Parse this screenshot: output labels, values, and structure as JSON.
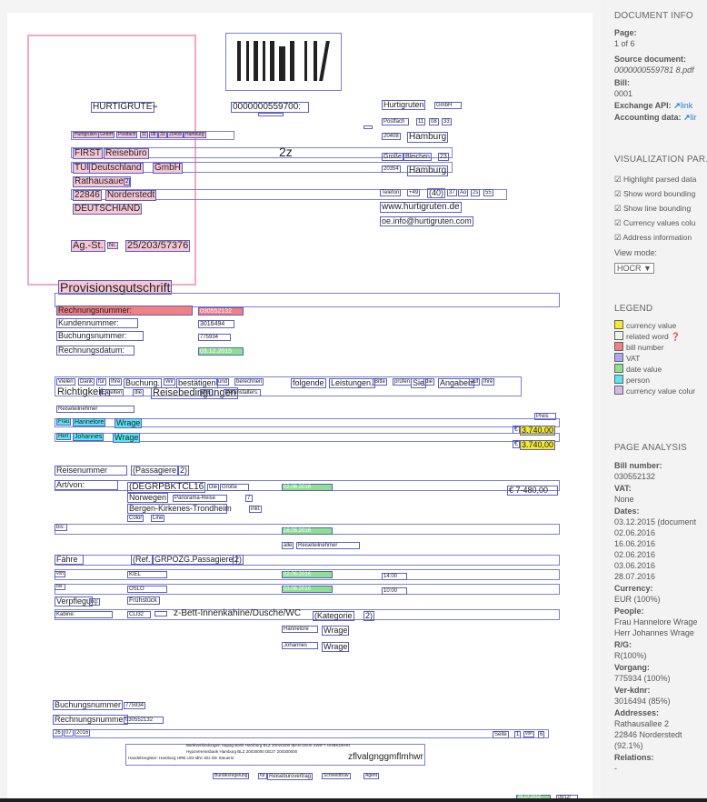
{
  "doc": {
    "company_top": "HURTIGRUTE",
    "company_top_mark": "™",
    "doc_number": "0000000559700:",
    "company_right": "Hurtigruten",
    "company_right_suffix": "GmbH",
    "sender_line": [
      "Hurtigruten",
      "GmbH",
      "Postfach",
      "11",
      "08",
      "33",
      "20408",
      "Hamburg"
    ],
    "postfach": [
      "Postfach",
      "11",
      "08",
      "33"
    ],
    "plz_hh1": "20408",
    "city_hh1": "Hamburg",
    "street_r": [
      "Große",
      "Bleichen",
      "23"
    ],
    "plz_hh2": "20354",
    "city_hh2": "Hamburg",
    "phone": [
      "Telefon",
      "+49",
      "(40)",
      "37",
      "Ao",
      "2s",
      "55"
    ],
    "web": "www.hurtigruten.de",
    "email": "oe.info@hurtigruten.com",
    "recipient": [
      "FIRST",
      "Reisebüro",
      "TUI",
      "Deutschland",
      "GmbH",
      "Rathausauee",
      "2",
      "22846",
      "Norderstedt",
      "DEUTSCHIAND"
    ],
    "zz": "2z",
    "agst": [
      "Ag.-St.",
      "Nr.",
      "25/203/57376"
    ],
    "title": "Provisionsgutschrift",
    "fields": {
      "rechnungsnummer_label": "Rechnungsnummer:",
      "rechnungsnummer": "030552132",
      "kundennummer_label": "Kundennummer:",
      "kundennummer": "3016494",
      "buchungsnummer_label": "Buchungsnummer:",
      "buchungsnummer": "775934",
      "rechnungsdatum_label": "Rechnungsdatum:",
      "rechnungsdatum": "03.12.2015"
    },
    "thanks_line": [
      "Vielen",
      "Dank",
      "für",
      "Ihre",
      "Buchung.",
      "Wir",
      "bestätigen",
      "und",
      "berechnen",
      "folgende",
      "Leistungen.",
      "Bitte",
      "prüfen",
      "Sie",
      "die",
      "Angaben",
      "auf",
      "Ihre"
    ],
    "rules_line": [
      "Richtigkeit.",
      "Es",
      "gelten",
      "die",
      "Reisebedingungen",
      "des",
      "Veranstalters."
    ],
    "reiseteilnehmer": "Reiseteilnehmer",
    "preis": "Preis",
    "pax": [
      {
        "title": "Frau",
        "first": "Hannelore",
        "last": "Wrage",
        "cur": "€",
        "amount": "3.740,00"
      },
      {
        "title": "Herr",
        "first": "Johannes",
        "last": "Wrage",
        "cur": "€",
        "amount": "3.740,00"
      }
    ],
    "reisenummer": "Reisenummer",
    "passagiere": [
      "(Passagiere",
      "2)"
    ],
    "artvon": "Art/von:",
    "trip_code": "(DEGRPBKTCL16",
    "die": "Die",
    "grosse": "Große",
    "norwegen": [
      "Norwegen",
      "Panorama-Reise",
      "7"
    ],
    "route": [
      "Bergen-Kirkenes-Trondheim",
      "inkl."
    ],
    "color_line": [
      "Color",
      "Line"
    ],
    "date1": "02.06.2016",
    "price_trip": "€ 7-480,00",
    "bis": "bis:",
    "date2": "16.06.2016",
    "alle_reiseteilnehmer": [
      "alle",
      "Reiseteilnehmer"
    ],
    "faehre": "Fähre",
    "ref": [
      "(Ref.",
      "GRPOZG.Passagiere:",
      "2)"
    ],
    "von_label": "von:",
    "kiel": "KIEL",
    "date3": "02.06.2016",
    "time1": "14:00",
    "bis2": "bis:",
    "oslo": "OSLO",
    "date4": "03.06.2016",
    "time2": "10:00",
    "verpflegung": [
      "Verpflegu",
      "ng:"
    ],
    "fruehstueck": "Frühstück",
    "kabine_label": "Kabine:",
    "cli32": "CLI32",
    "kabine_text": "z-Bett-Innenkahine/Dusche/WC",
    "kategorie": [
      "(Kategorie",
      "2)"
    ],
    "names_bottom": [
      [
        "Hannelore",
        "Wrage"
      ],
      [
        "Johannes",
        "Wrage"
      ]
    ],
    "footer_buchung": [
      "Buchungsnummer",
      "775934"
    ],
    "footer_rechnung": [
      "Rechnungsnummer",
      "030552132"
    ],
    "footer_date": [
      "26",
      "07",
      "2016"
    ],
    "seite": [
      "Seite",
      "1",
      "von",
      "6"
    ],
    "bank_line": "Bankverbindungen Hapag  Bank  Hamburg  BLZ  20020200  IBAN DE00  SWIFT  GHBKDEHH",
    "bank_line2": "HypoVereinsbank Hamburg  BLZ 20030000  DE27 200300000",
    "reg_line": "Handelsregister: Hamburg HRB  USt-IdNr  Sitz  DE  Steuernr.",
    "garbled": "zflvalgnggmflmhwr",
    "bundes": [
      "Bundesregelung",
      "für",
      "Reisebürovertrag",
      "Schneidtrüw",
      "Agent"
    ],
    "bottom_green": "28.07.2016",
    "bottom_small": "05/12/"
  },
  "sidebar": {
    "document_info": "DOCUMENT INFO",
    "page_label": "Page:",
    "page_value": "1 of 6",
    "source_label": "Source document:",
    "source_value": "0000000559781 8.pdf",
    "bill_label": "Bill:",
    "bill_value": "0001",
    "exchange_label": "Exchange API:",
    "exchange_link": "link",
    "accounting_label": "Accounting data:",
    "accounting_link": "lir",
    "vis_title": "VISUALIZATION PAR.",
    "vis_options": [
      "Highlight parsed data",
      "Show word bounding",
      "Show line bounding",
      "Currency values colu",
      "Address information"
    ],
    "view_mode_label": "View mode:",
    "view_mode_value": "HOCR ▼",
    "legend_title": "LEGEND",
    "legend": [
      {
        "label": "currency value",
        "color": "#f2ea2a"
      },
      {
        "label": "related word",
        "color": "#e8f5e8"
      },
      {
        "label": "bill number",
        "color": "#f28080"
      },
      {
        "label": "VAT",
        "color": "#a9a9f2"
      },
      {
        "label": "date value",
        "color": "#8de08d"
      },
      {
        "label": "person",
        "color": "#58e6f0"
      },
      {
        "label": "currency value colur",
        "color": "#d7b7e8"
      }
    ],
    "analysis_title": "PAGE ANALYSIS",
    "analysis": [
      {
        "label": "Bill number:",
        "values": [
          "030552132"
        ]
      },
      {
        "label": "VAT:",
        "values": [
          "None"
        ]
      },
      {
        "label": "Dates:",
        "values": [
          "03.12.2015 (document",
          "02.06.2016",
          "16.06.2016",
          "02.06.2016",
          "03.06.2016",
          "28.07.2016"
        ]
      },
      {
        "label": "Currency:",
        "values": [
          "EUR (100%)"
        ]
      },
      {
        "label": "People:",
        "values": [
          "Frau Hannelore Wrage",
          "Herr Johannes Wrage"
        ]
      },
      {
        "label": "R/G:",
        "values": [
          "R(100%)"
        ]
      },
      {
        "label": "Vorgang:",
        "values": [
          "775934 (100%)"
        ]
      },
      {
        "label": "Ver-kdnr:",
        "values": [
          "3016494 (85%)"
        ]
      },
      {
        "label": "Addresses:",
        "values": [
          "Rathausallee 2",
          "22846 Norderstedt",
          "(92.1%)"
        ]
      },
      {
        "label": "Relations:",
        "values": [
          "-"
        ]
      }
    ]
  }
}
